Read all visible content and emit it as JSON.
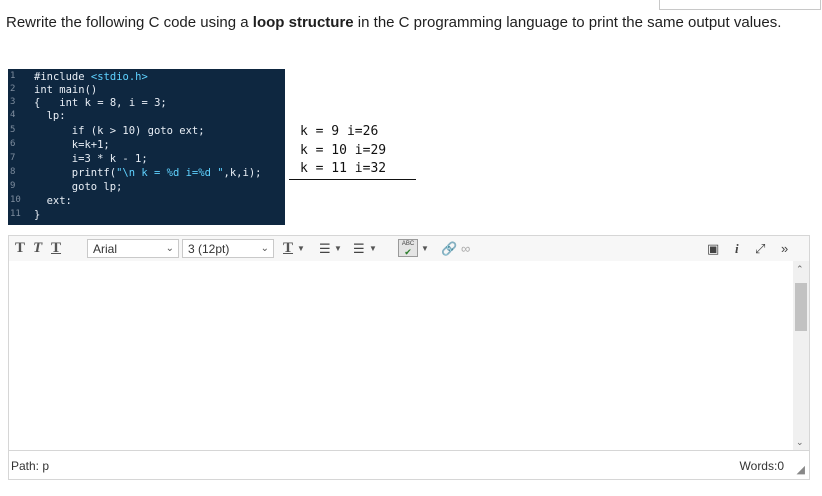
{
  "question": {
    "part1": "Rewrite the following C code using a ",
    "bold": "loop structure",
    "part2": " in the C programming language to print the same output values."
  },
  "code_lines": [
    {
      "n": "1",
      "indent": 0,
      "text": "#include <stdio.h>"
    },
    {
      "n": "2",
      "indent": 0,
      "text": "int main()"
    },
    {
      "n": "3",
      "indent": 0,
      "text": "{   int k = 8, i = 3;"
    },
    {
      "n": "4",
      "indent": 2,
      "text": "lp:"
    },
    {
      "n": "5",
      "indent": 6,
      "text": "if (k > 10) goto ext;"
    },
    {
      "n": "6",
      "indent": 6,
      "text": "k=k+1;"
    },
    {
      "n": "7",
      "indent": 6,
      "text": "i=3 * k - 1;"
    },
    {
      "n": "8",
      "indent": 6,
      "text": "printf(\"\\n k = %d i=%d \",k,i);"
    },
    {
      "n": "9",
      "indent": 6,
      "text": "goto lp;"
    },
    {
      "n": "10",
      "indent": 2,
      "text": "ext:"
    },
    {
      "n": "11",
      "indent": 0,
      "text": "}"
    }
  ],
  "output_lines": [
    "k = 9 i=26",
    "k = 10 i=29",
    "k = 11 i=32"
  ],
  "toolbar": {
    "bold_label": "T",
    "italic_label": "T",
    "underline_label": "T",
    "font_family": "Arial",
    "font_size": "3 (12pt)",
    "spell_label": "ABC"
  },
  "status": {
    "path_label": "Path: p",
    "words_label": "Words:0"
  }
}
